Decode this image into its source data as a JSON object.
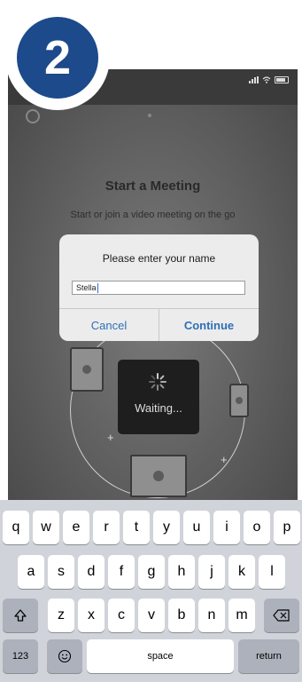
{
  "step_badge": {
    "number": "2",
    "color": "#1c4a8a"
  },
  "status_bar": {
    "icons": [
      "cellular-signal-icon",
      "wifi-icon",
      "battery-icon"
    ]
  },
  "top_bar": {
    "icons": [
      "gear-icon"
    ]
  },
  "main": {
    "title": "Start a Meeting",
    "subtitle": "Start or join a video meeting on the go",
    "waiting_label": "Waiting..."
  },
  "dialog": {
    "title": "Please enter your name",
    "input_value": "Stella",
    "cancel_label": "Cancel",
    "continue_label": "Continue",
    "accent_color": "#2d6fb5"
  },
  "keyboard": {
    "row1": [
      "q",
      "w",
      "e",
      "r",
      "t",
      "y",
      "u",
      "i",
      "o",
      "p"
    ],
    "row2": [
      "a",
      "s",
      "d",
      "f",
      "g",
      "h",
      "j",
      "k",
      "l"
    ],
    "row3": [
      "z",
      "x",
      "c",
      "v",
      "b",
      "n",
      "m"
    ],
    "numbers_label": "123",
    "space_label": "space",
    "return_label": "return",
    "icons": [
      "shift-icon",
      "backspace-icon",
      "emoji-icon"
    ]
  }
}
